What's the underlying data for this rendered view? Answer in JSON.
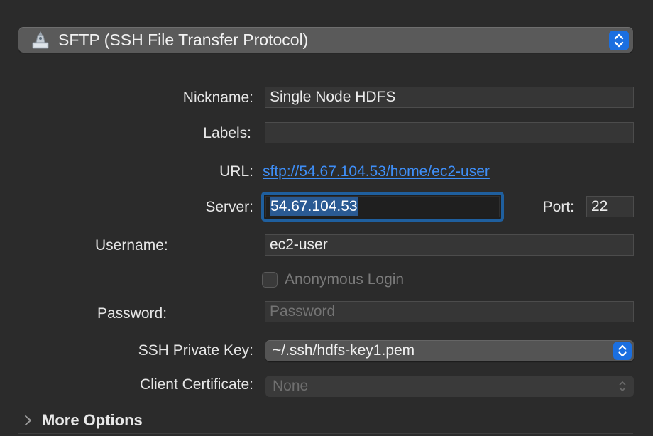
{
  "protocol": {
    "label": "SFTP (SSH File Transfer Protocol)",
    "icon": "network-drive-icon"
  },
  "form": {
    "nickname": {
      "label": "Nickname:",
      "value": "Single Node HDFS"
    },
    "labels": {
      "label": "Labels:",
      "value": ""
    },
    "url": {
      "label": "URL:",
      "value": "sftp://54.67.104.53/home/ec2-user"
    },
    "server": {
      "label": "Server:",
      "value": "54.67.104.53"
    },
    "port": {
      "label": "Port:",
      "value": "22"
    },
    "username": {
      "label": "Username:",
      "value": "ec2-user"
    },
    "anonymous": {
      "label": "Anonymous Login",
      "checked": false
    },
    "password": {
      "label": "Password:",
      "placeholder": "Password",
      "value": ""
    },
    "ssh_key": {
      "label": "SSH Private Key:",
      "value": "~/.ssh/hdfs-key1.pem"
    },
    "client_cert": {
      "label": "Client Certificate:",
      "value": "None"
    }
  },
  "more_options": {
    "label": "More Options"
  },
  "colors": {
    "accent": "#1b6fe0",
    "link": "#3e8ef7",
    "focus_ring": "#1f5f9e",
    "background": "#2b2b2b"
  }
}
